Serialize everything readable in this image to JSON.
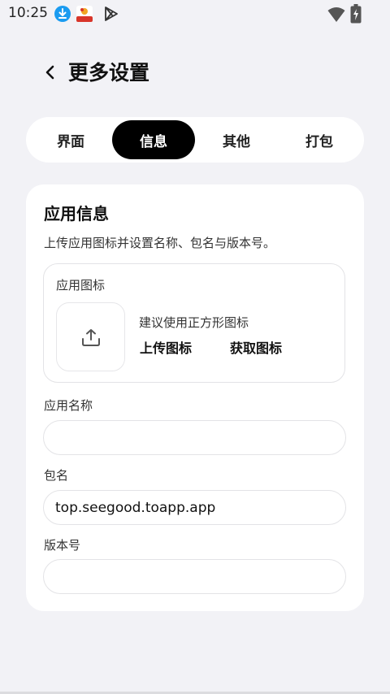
{
  "status_bar": {
    "time": "10:25",
    "icons": [
      "download-icon",
      "app-notification-icon",
      "play-store-icon",
      "wifi-icon",
      "battery-icon"
    ]
  },
  "header": {
    "back_icon": "chevron-left-icon",
    "title": "更多设置"
  },
  "tabs": [
    {
      "label": "界面",
      "active": false
    },
    {
      "label": "信息",
      "active": true
    },
    {
      "label": "其他",
      "active": false
    },
    {
      "label": "打包",
      "active": false
    }
  ],
  "app_info": {
    "title": "应用信息",
    "description": "上传应用图标并设置名称、包名与版本号。",
    "icon_section": {
      "label": "应用图标",
      "upload_icon": "upload-icon",
      "hint": "建议使用正方形图标",
      "upload_label": "上传图标",
      "fetch_label": "获取图标"
    },
    "name_field": {
      "label": "应用名称",
      "value": ""
    },
    "package_field": {
      "label": "包名",
      "value": "top.seegood.toapp.app"
    },
    "version_field": {
      "label": "版本号",
      "value": ""
    }
  },
  "colors": {
    "background": "#f2f2f6",
    "card": "#ffffff",
    "active_tab": "#000000",
    "border": "#e3e3e6"
  }
}
